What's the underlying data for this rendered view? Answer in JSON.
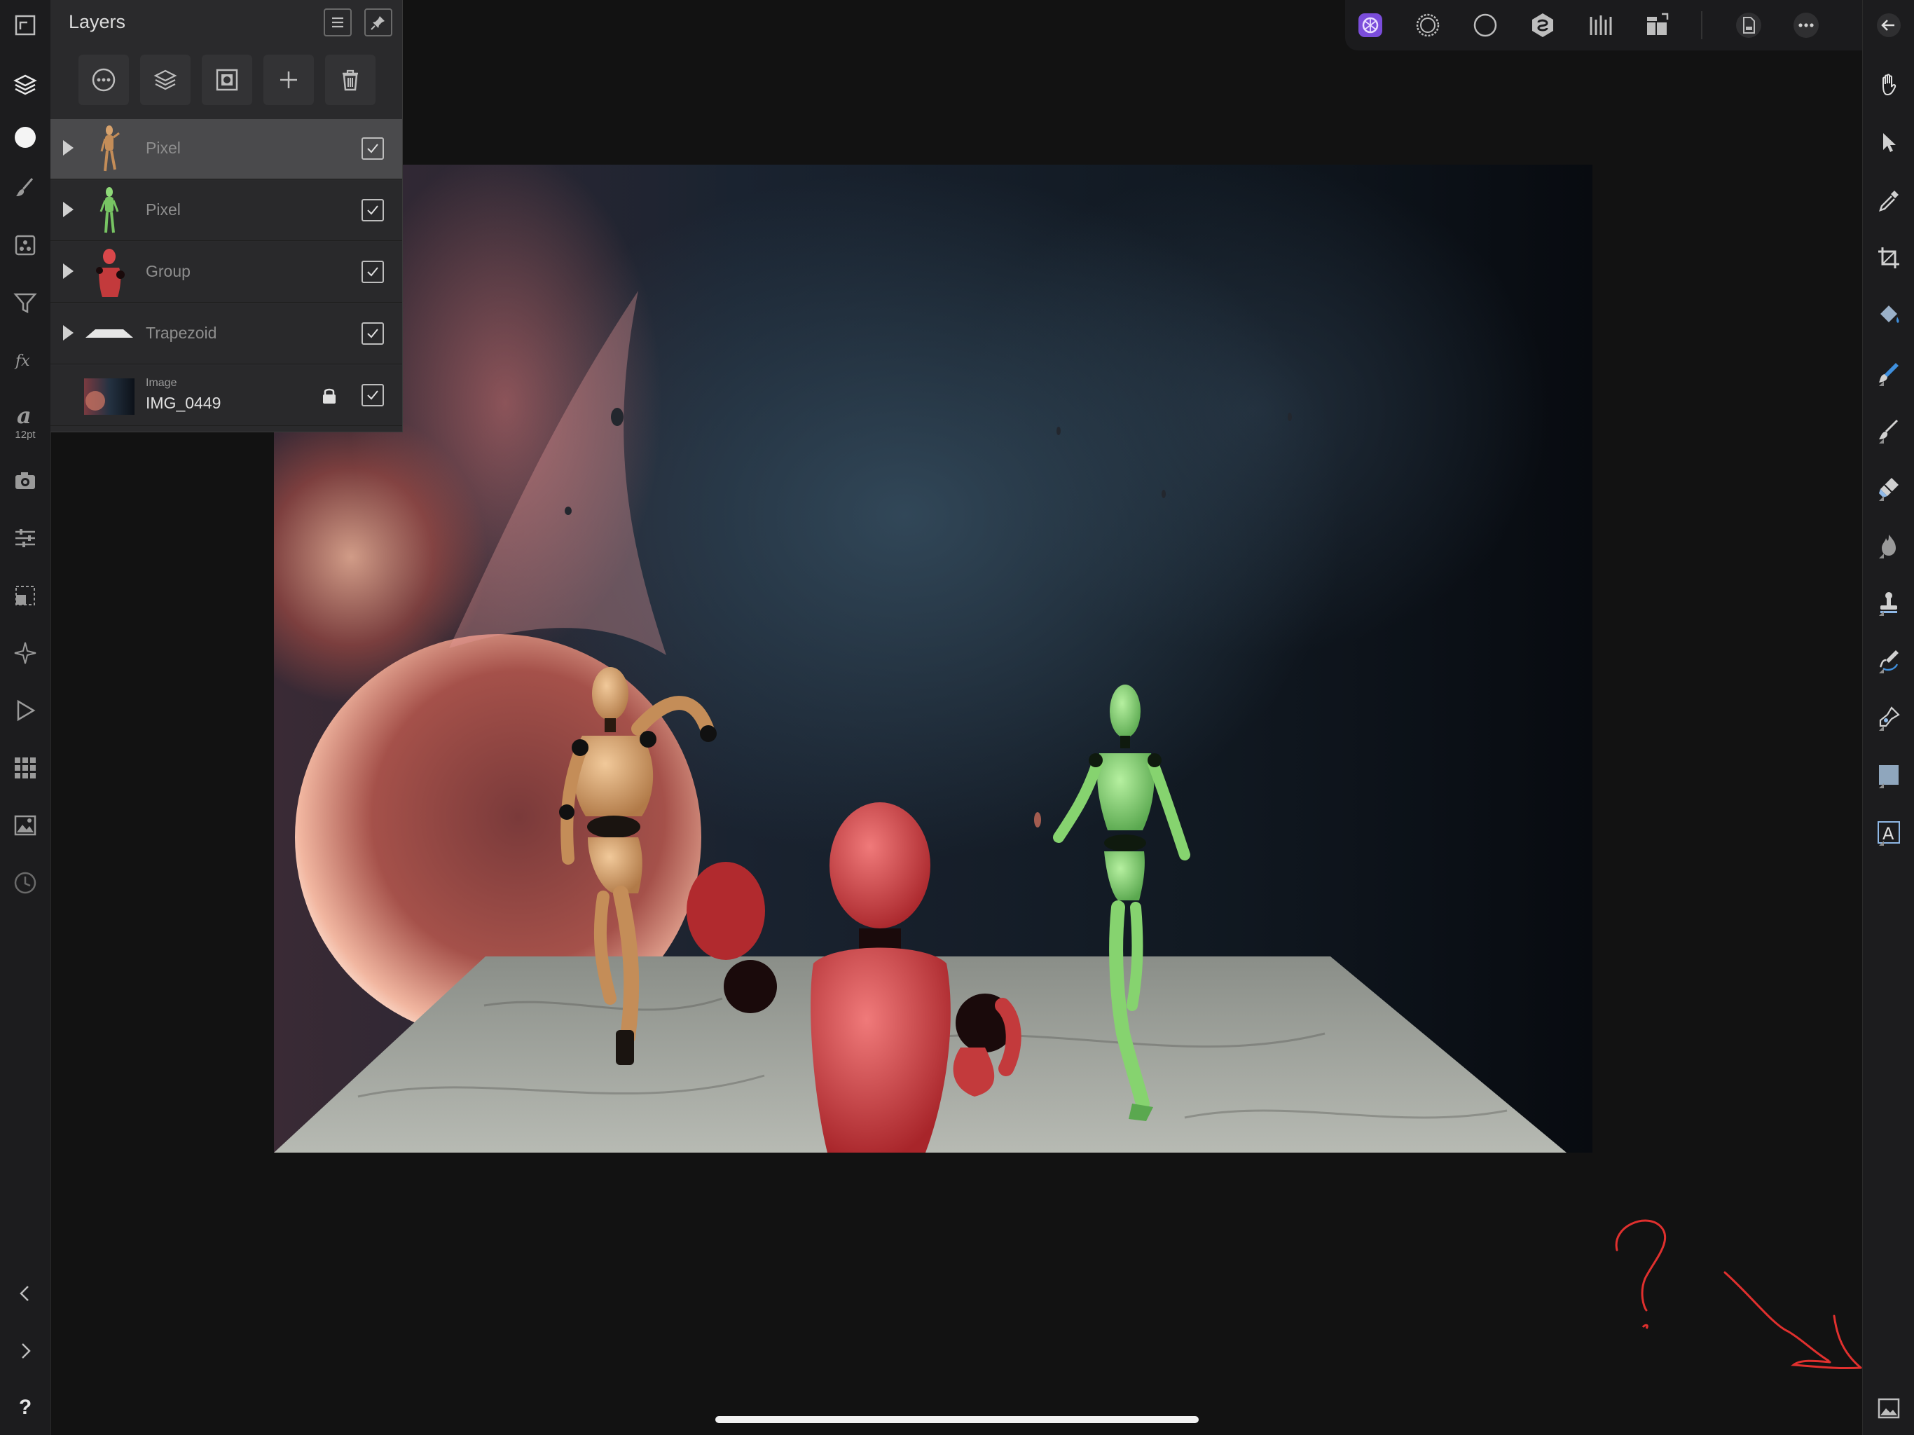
{
  "layers_panel": {
    "title": "Layers",
    "layers": [
      {
        "name": "Pixel",
        "visible": true,
        "selected": true,
        "expandable": true
      },
      {
        "name": "Pixel",
        "visible": true,
        "selected": false,
        "expandable": true
      },
      {
        "name": "Group",
        "visible": true,
        "selected": false,
        "expandable": true
      },
      {
        "name": "Trapezoid",
        "visible": true,
        "selected": false,
        "expandable": true
      },
      {
        "kind": "Image",
        "name": "IMG_0449",
        "visible": true,
        "locked": true,
        "expandable": false
      }
    ]
  },
  "left_bar": {
    "text_size": "12pt",
    "help": "?"
  },
  "colors": {
    "accent": "#7b4ddb",
    "annotation": "#e0302e",
    "selected_row": "#4a4a4c"
  }
}
